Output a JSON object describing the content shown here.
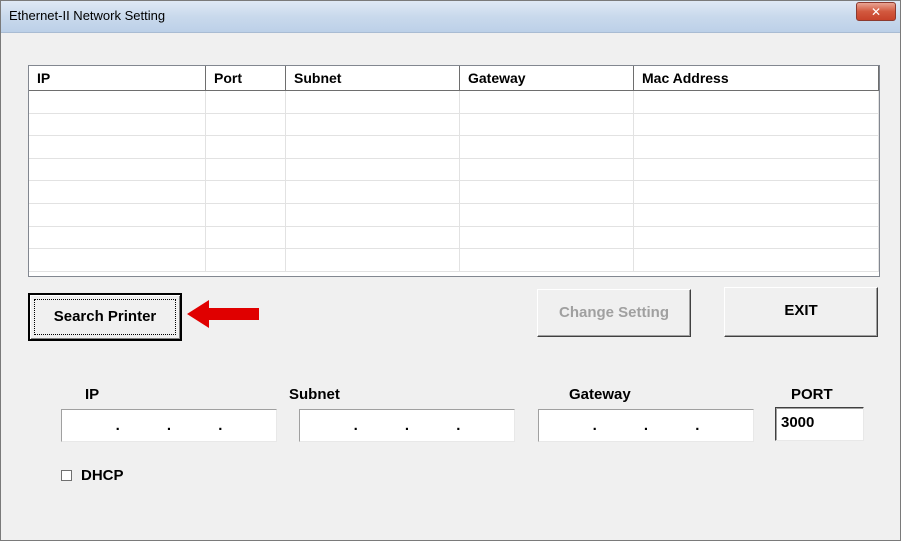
{
  "window": {
    "title": "Ethernet-II Network Setting",
    "close_label": "✕"
  },
  "list": {
    "columns": [
      "IP",
      "Port",
      "Subnet",
      "Gateway",
      "Mac Address"
    ],
    "row_count": 8
  },
  "buttons": {
    "search": "Search Printer",
    "change": "Change Setting",
    "exit": "EXIT"
  },
  "fields": {
    "ip_label": "IP",
    "subnet_label": "Subnet",
    "gateway_label": "Gateway",
    "port_label": "PORT",
    "port_value": "3000",
    "dot": "."
  },
  "dhcp": {
    "label": "DHCP",
    "checked": false
  },
  "colors": {
    "arrow": "#e00000"
  }
}
